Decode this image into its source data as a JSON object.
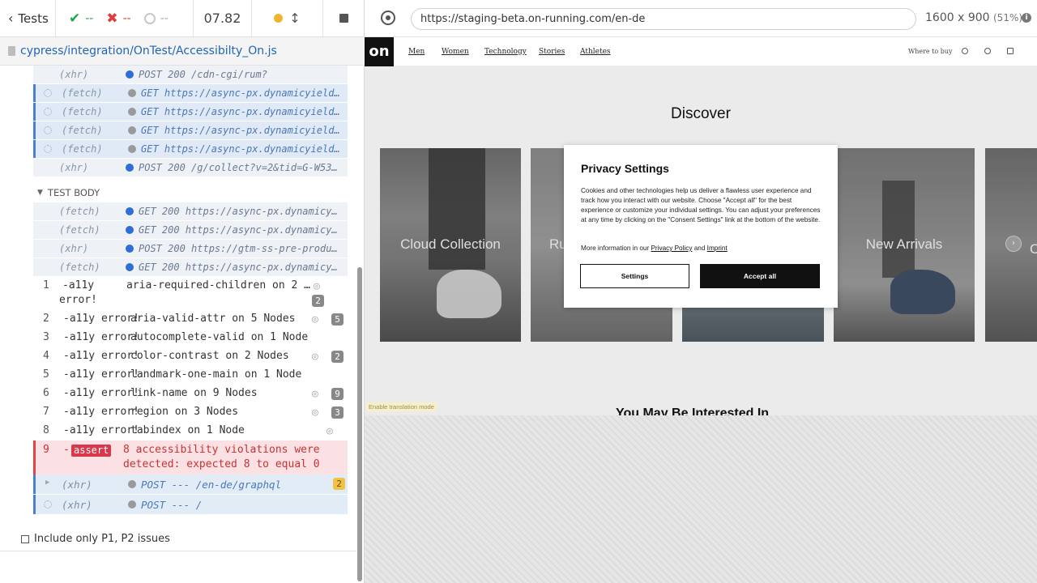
{
  "topbar": {
    "tests_label": "Tests",
    "passed": "--",
    "failed": "--",
    "pending": "--",
    "duration": "07.82"
  },
  "spec": {
    "path": "cypress/integration/OnTest/Accessibilty_On.js"
  },
  "commands_before": [
    {
      "type": "(xhr)",
      "msg": "POST 200 /cdn-cgi/rum?",
      "style": "grey",
      "bullet": "b",
      "spinner": false
    },
    {
      "type": "(fetch)",
      "msg": "GET https://async-px.dynamicyield.com/dp…",
      "style": "blue",
      "bullet": "g",
      "spinner": true
    },
    {
      "type": "(fetch)",
      "msg": "GET https://async-px.dynamicyield.com/dp…",
      "style": "blue",
      "bullet": "g",
      "spinner": true
    },
    {
      "type": "(fetch)",
      "msg": "GET https://async-px.dynamicyield.com/dp…",
      "style": "blue",
      "bullet": "g",
      "spinner": true
    },
    {
      "type": "(fetch)",
      "msg": "GET https://async-px.dynamicyield.com/dp…",
      "style": "blue",
      "bullet": "g",
      "spinner": true
    },
    {
      "type": "(xhr)",
      "msg": "POST 200 /g/collect?v=2&tid=G-W530XQ4V1F…",
      "style": "grey",
      "bullet": "b",
      "spinner": false
    }
  ],
  "test_body_label": "TEST BODY",
  "commands_body": [
    {
      "type": "(fetch)",
      "msg": "GET 200 https://async-px.dynamicyield.co…"
    },
    {
      "type": "(fetch)",
      "msg": "GET 200 https://async-px.dynamicyield.co…"
    },
    {
      "type": "(xhr)",
      "msg": "POST 200 https://gtm-ss-pre-production.o…"
    },
    {
      "type": "(fetch)",
      "msg": "GET 200 https://async-px.dynamicyield.co…"
    }
  ],
  "a11y_label": "-a11y error!",
  "a11y_first_label_a": "-a11y",
  "a11y_first_label_b": "error!",
  "a11y_rows": [
    {
      "n": "1",
      "text": "aria-required-children on 2 No…",
      "count": "2",
      "eye": true
    },
    {
      "n": "2",
      "text": "aria-valid-attr on 5 Nodes",
      "count": "5",
      "eye": true
    },
    {
      "n": "3",
      "text": "autocomplete-valid on 1 Node",
      "count": "",
      "eye": false
    },
    {
      "n": "4",
      "text": "color-contrast on 2 Nodes",
      "count": "2",
      "eye": true
    },
    {
      "n": "5",
      "text": "landmark-one-main on 1 Node",
      "count": "",
      "eye": false
    },
    {
      "n": "6",
      "text": "link-name on 9 Nodes",
      "count": "9",
      "eye": true
    },
    {
      "n": "7",
      "text": "region on 3 Nodes",
      "count": "3",
      "eye": true
    },
    {
      "n": "8",
      "text": "tabindex on 1 Node",
      "count": "",
      "eye": true
    }
  ],
  "assert": {
    "n": "9",
    "dash": "-",
    "badge": "assert",
    "msg": "8 accessibility violations were detected: expected 8 to equal 0"
  },
  "pending_requests": [
    {
      "type": "(xhr)",
      "msg": "POST --- /en-de/graphql",
      "count": "2",
      "expandable": true
    },
    {
      "type": "(xhr)",
      "msg": "POST --- /",
      "count": "",
      "expandable": false
    }
  ],
  "p1p2_label": "Include only P1, P2 issues",
  "aut": {
    "url": "https://staging-beta.on-running.com/en-de",
    "viewport": "1600 x 900",
    "scale": "(51%)"
  },
  "site": {
    "logo": "on",
    "nav": [
      "Men",
      "Women",
      "Technology",
      "Stories",
      "Athletes"
    ],
    "where_to_buy": "Where to buy",
    "discover": "Discover",
    "tiles": [
      "Cloud Collection",
      "Ru",
      "",
      "New Arrivals",
      "Co"
    ],
    "translate": "Enable translation mode",
    "interested": "You May Be Interested In"
  },
  "privacy": {
    "title": "Privacy Settings",
    "body": "Cookies and other technologies help us deliver a flawless user experience and track how you interact with our website. Choose \"Accept all\" for the best experience or customize your individual settings. You can adjust your preferences at any time by clicking on the \"Consent Settings\" link at the bottom of the website.",
    "more_prefix": "More information in our",
    "policy_link": "Privacy Policy",
    "and": "and",
    "imprint_link": "Imprint",
    "settings_btn": "Settings",
    "accept_btn": "Accept all"
  },
  "colors": {
    "pass": "#1ea84b",
    "fail": "#e23b3b",
    "link": "#1f66b5",
    "assert_bg": "#fbe1e3"
  }
}
